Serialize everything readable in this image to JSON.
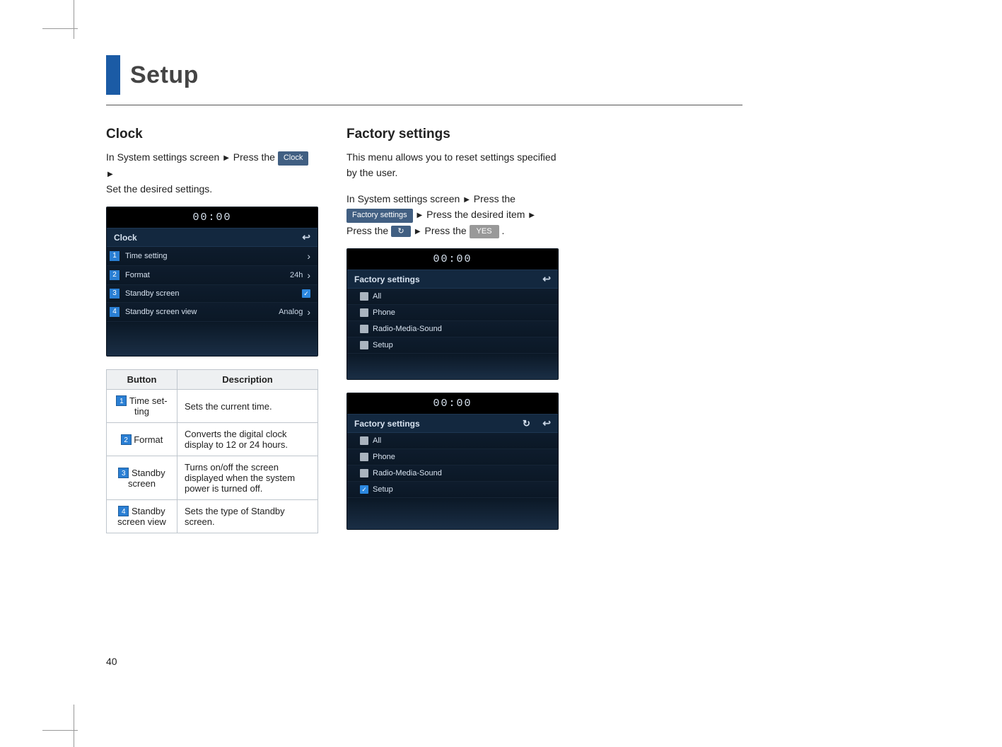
{
  "page": {
    "title": "Setup",
    "number": "40"
  },
  "clock": {
    "heading": "Clock",
    "instr_prefix": "In System settings screen ",
    "instr_mid": " Press the ",
    "pill": "Clock",
    "instr_suffix": "Set the desired settings.",
    "screen": {
      "time": "00:00",
      "title": "Clock",
      "rows": [
        {
          "num": "1",
          "label": "Time setting",
          "value": "",
          "extra": "chevron"
        },
        {
          "num": "2",
          "label": "Format",
          "value": "24h",
          "extra": "chevron"
        },
        {
          "num": "3",
          "label": "Standby screen",
          "value": "",
          "extra": "check"
        },
        {
          "num": "4",
          "label": "Standby screen view",
          "value": "Analog",
          "extra": "chevron"
        }
      ]
    },
    "table": {
      "head_button": "Button",
      "head_desc": "Description",
      "rows": [
        {
          "num": "1",
          "label": "Time set-\nting",
          "desc": "Sets the current time."
        },
        {
          "num": "2",
          "label": "Format",
          "desc": "Converts the digital clock display to 12 or 24 hours."
        },
        {
          "num": "3",
          "label": "Standby screen",
          "desc": "Turns on/off the screen displayed when the system power is turned off."
        },
        {
          "num": "4",
          "label": "Standby screen view",
          "desc": "Sets the type of Standby screen."
        }
      ]
    }
  },
  "factory": {
    "heading": "Factory settings",
    "intro": "This menu allows you to reset settings specified by the user.",
    "instr_prefix": "In System settings screen ",
    "instr_pressthe": " Press the ",
    "pill": "Factory settings",
    "instr_item": " Press the desired item ",
    "instr_press2": "Press the ",
    "yes": "YES",
    "period": ".",
    "screen1": {
      "time": "00:00",
      "title": "Factory settings",
      "items": [
        "All",
        "Phone",
        "Radio-Media-Sound",
        "Setup"
      ]
    },
    "screen2": {
      "time": "00:00",
      "title": "Factory settings",
      "items": [
        "All",
        "Phone",
        "Radio-Media-Sound",
        "Setup"
      ],
      "checked": 3
    }
  }
}
